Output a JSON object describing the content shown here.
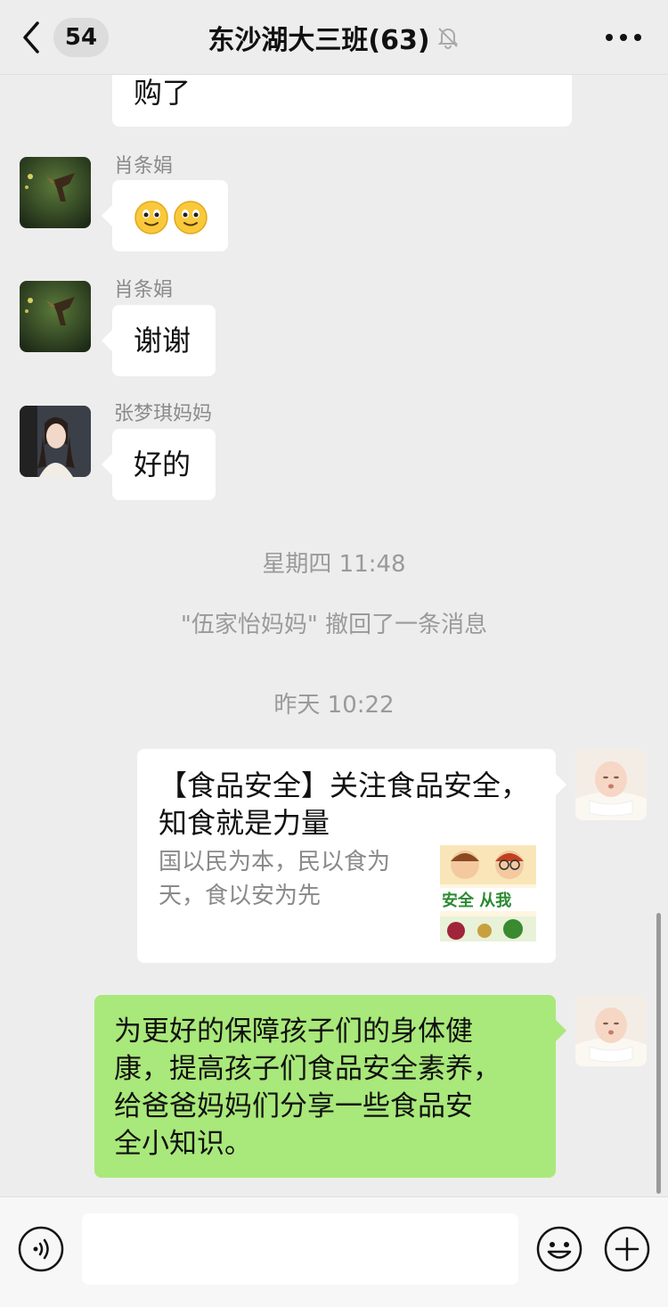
{
  "header": {
    "back_count": "54",
    "title": "东沙湖大三班(63)",
    "mute_icon": "bell-slash-icon",
    "more_icon": "more-dots-icon"
  },
  "messages": [
    {
      "type": "text",
      "side": "left",
      "text": "购了"
    },
    {
      "type": "emoji",
      "side": "left",
      "sender": "肖条娟",
      "emoji_names": [
        "smile-emoji",
        "smile-emoji"
      ]
    },
    {
      "type": "text",
      "side": "left",
      "sender": "肖条娟",
      "text": "谢谢"
    },
    {
      "type": "text",
      "side": "left",
      "sender": "张梦琪妈妈",
      "text": "好的"
    },
    {
      "type": "time",
      "text": "星期四 11:48"
    },
    {
      "type": "system",
      "text": "\"伍家怡妈妈\" 撤回了一条消息"
    },
    {
      "type": "time",
      "text": "昨天 10:22"
    },
    {
      "type": "link-card",
      "side": "right",
      "title_line1": "【食品安全】关注食品安全，",
      "title_line2": "知食就是力量",
      "desc_line1": "国以民为本，民以食为",
      "desc_line2": "天，食以安为先",
      "thumb_text": "安全  从我"
    },
    {
      "type": "text",
      "side": "right",
      "color": "#a9e87a",
      "lines": [
        "为更好的保障孩子们的身体健",
        "康，提高孩子们食品安全素养，",
        "给爸爸妈妈们分享一些食品安",
        "全小知识。"
      ]
    }
  ],
  "input_bar": {
    "voice_icon": "voice-icon",
    "emoji_icon": "emoji-icon",
    "plus_icon": "plus-icon",
    "input_value": ""
  },
  "colors": {
    "background": "#ededed",
    "bubble_white": "#ffffff",
    "bubble_green": "#a9e87a",
    "meta_text": "#9a9a9a"
  }
}
